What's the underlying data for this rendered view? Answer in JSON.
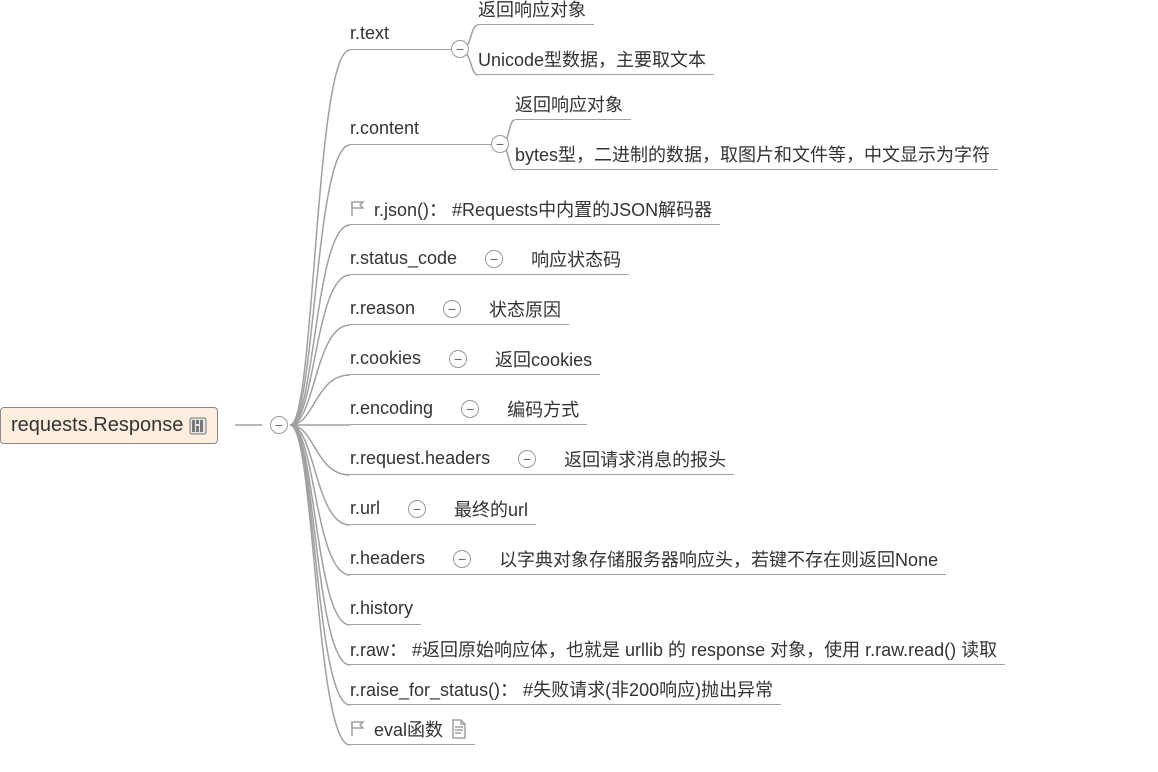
{
  "root": {
    "label": "requests.Response"
  },
  "children": [
    {
      "key": "rtext",
      "label": "r.text",
      "toggle": "−",
      "sub": [
        {
          "key": "rtext_a",
          "label": "返回响应对象"
        },
        {
          "key": "rtext_b",
          "label": "Unicode型数据，主要取文本"
        }
      ]
    },
    {
      "key": "rcontent",
      "label": "r.content",
      "toggle": "−",
      "sub": [
        {
          "key": "rcontent_a",
          "label": "返回响应对象"
        },
        {
          "key": "rcontent_b",
          "label": "bytes型，二进制的数据，取图片和文件等，中文显示为字符"
        }
      ]
    },
    {
      "key": "rjson",
      "flag": true,
      "label": "r.json()：  #Requests中内置的JSON解码器"
    },
    {
      "key": "rstatus",
      "label": "r.status_code",
      "toggle": "−",
      "detail": "响应状态码"
    },
    {
      "key": "rreason",
      "label": "r.reason",
      "toggle": "−",
      "detail": "状态原因"
    },
    {
      "key": "rcookies",
      "label": "r.cookies",
      "toggle": "−",
      "detail": "返回cookies"
    },
    {
      "key": "rencoding",
      "label": "r.encoding",
      "toggle": "−",
      "detail": "编码方式"
    },
    {
      "key": "rreqheaders",
      "label": "r.request.headers",
      "toggle": "−",
      "detail": "返回请求消息的报头"
    },
    {
      "key": "rurl",
      "label": "r.url",
      "toggle": "−",
      "detail": "最终的url"
    },
    {
      "key": "rheaders",
      "label": "r.headers",
      "toggle": "−",
      "detail": "以字典对象存储服务器响应头，若键不存在则返回None"
    },
    {
      "key": "rhistory",
      "label": "r.history"
    },
    {
      "key": "rraw",
      "label": "r.raw：  #返回原始响应体，也就是 urllib 的 response 对象，使用 r.raw.read() 读取"
    },
    {
      "key": "rraise",
      "label": "r.raise_for_status()：  #失败请求(非200响应)抛出异常"
    },
    {
      "key": "reval",
      "flag": true,
      "note": true,
      "label": "eval函数"
    }
  ]
}
